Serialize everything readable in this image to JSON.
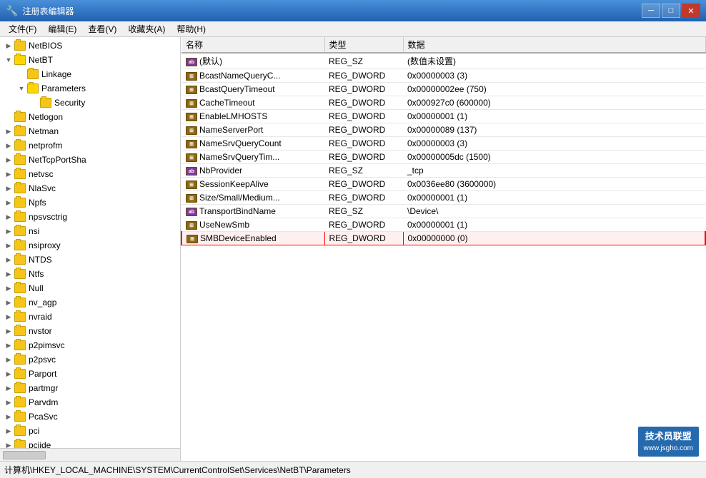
{
  "titleBar": {
    "title": "注册表编辑器",
    "iconUnicode": "🔧",
    "minBtn": "─",
    "maxBtn": "□",
    "closeBtn": "✕"
  },
  "menuBar": {
    "items": [
      {
        "label": "文件(F)"
      },
      {
        "label": "编辑(E)"
      },
      {
        "label": "查看(V)"
      },
      {
        "label": "收藏夹(A)"
      },
      {
        "label": "帮助(H)"
      }
    ]
  },
  "tree": {
    "items": [
      {
        "id": "netbios",
        "label": "NetBIOS",
        "level": 1,
        "expanded": false,
        "selected": false
      },
      {
        "id": "netbt",
        "label": "NetBT",
        "level": 1,
        "expanded": true,
        "selected": false
      },
      {
        "id": "linkage",
        "label": "Linkage",
        "level": 2,
        "expanded": false,
        "selected": false
      },
      {
        "id": "parameters",
        "label": "Parameters",
        "level": 2,
        "expanded": true,
        "selected": false
      },
      {
        "id": "security",
        "label": "Security",
        "level": 3,
        "expanded": false,
        "selected": false
      },
      {
        "id": "netlogon",
        "label": "Netlogon",
        "level": 1,
        "expanded": false,
        "selected": false
      },
      {
        "id": "netman",
        "label": "Netman",
        "level": 1,
        "expanded": false,
        "selected": false
      },
      {
        "id": "netprofm",
        "label": "netprofm",
        "level": 1,
        "expanded": false,
        "selected": false
      },
      {
        "id": "nettcpportsha",
        "label": "NetTcpPortSha",
        "level": 1,
        "expanded": false,
        "selected": false
      },
      {
        "id": "netvsc",
        "label": "netvsc",
        "level": 1,
        "expanded": false,
        "selected": false
      },
      {
        "id": "nlasvc",
        "label": "NlaSvc",
        "level": 1,
        "expanded": false,
        "selected": false
      },
      {
        "id": "npfs",
        "label": "Npfs",
        "level": 1,
        "expanded": false,
        "selected": false
      },
      {
        "id": "npsvsctrig",
        "label": "npsvsctrig",
        "level": 1,
        "expanded": false,
        "selected": false
      },
      {
        "id": "nsi",
        "label": "nsi",
        "level": 1,
        "expanded": false,
        "selected": false
      },
      {
        "id": "nsiproxy",
        "label": "nsiproxy",
        "level": 1,
        "expanded": false,
        "selected": false
      },
      {
        "id": "ntds",
        "label": "NTDS",
        "level": 1,
        "expanded": false,
        "selected": false
      },
      {
        "id": "ntfs",
        "label": "Ntfs",
        "level": 1,
        "expanded": false,
        "selected": false
      },
      {
        "id": "null",
        "label": "Null",
        "level": 1,
        "expanded": false,
        "selected": false
      },
      {
        "id": "nv_agp",
        "label": "nv_agp",
        "level": 1,
        "expanded": false,
        "selected": false
      },
      {
        "id": "nvraid",
        "label": "nvraid",
        "level": 1,
        "expanded": false,
        "selected": false
      },
      {
        "id": "nvstor",
        "label": "nvstor",
        "level": 1,
        "expanded": false,
        "selected": false
      },
      {
        "id": "p2pimsvc",
        "label": "p2pimsvc",
        "level": 1,
        "expanded": false,
        "selected": false
      },
      {
        "id": "p2psvc",
        "label": "p2psvc",
        "level": 1,
        "expanded": false,
        "selected": false
      },
      {
        "id": "parport",
        "label": "Parport",
        "level": 1,
        "expanded": false,
        "selected": false
      },
      {
        "id": "partmgr",
        "label": "partmgr",
        "level": 1,
        "expanded": false,
        "selected": false
      },
      {
        "id": "parvdm",
        "label": "Parvdm",
        "level": 1,
        "expanded": false,
        "selected": false
      },
      {
        "id": "pcasvc",
        "label": "PcaSvc",
        "level": 1,
        "expanded": false,
        "selected": false
      },
      {
        "id": "pci",
        "label": "pci",
        "level": 1,
        "expanded": false,
        "selected": false
      },
      {
        "id": "pciide",
        "label": "pciide",
        "level": 1,
        "expanded": false,
        "selected": false
      }
    ]
  },
  "tableHeaders": [
    "名称",
    "类型",
    "数据"
  ],
  "tableRows": [
    {
      "name": "(默认)",
      "typeIcon": "ab",
      "type": "REG_SZ",
      "data": "(数值未设置)"
    },
    {
      "name": "BcastNameQueryC...",
      "typeIcon": "reg",
      "type": "REG_DWORD",
      "data": "0x00000003 (3)"
    },
    {
      "name": "BcastQueryTimeout",
      "typeIcon": "reg",
      "type": "REG_DWORD",
      "data": "0x00000002ee (750)"
    },
    {
      "name": "CacheTimeout",
      "typeIcon": "reg",
      "type": "REG_DWORD",
      "data": "0x000927c0 (600000)"
    },
    {
      "name": "EnableLMHOSTS",
      "typeIcon": "reg",
      "type": "REG_DWORD",
      "data": "0x00000001 (1)"
    },
    {
      "name": "NameServerPort",
      "typeIcon": "reg",
      "type": "REG_DWORD",
      "data": "0x00000089 (137)"
    },
    {
      "name": "NameSrvQueryCount",
      "typeIcon": "reg",
      "type": "REG_DWORD",
      "data": "0x00000003 (3)"
    },
    {
      "name": "NameSrvQueryTim...",
      "typeIcon": "reg",
      "type": "REG_DWORD",
      "data": "0x00000005dc (1500)"
    },
    {
      "name": "NbProvider",
      "typeIcon": "ab",
      "type": "REG_SZ",
      "data": "_tcp"
    },
    {
      "name": "SessionKeepAlive",
      "typeIcon": "reg",
      "type": "REG_DWORD",
      "data": "0x0036ee80 (3600000)"
    },
    {
      "name": "Size/Small/Medium...",
      "typeIcon": "reg",
      "type": "REG_DWORD",
      "data": "0x00000001 (1)"
    },
    {
      "name": "TransportBindName",
      "typeIcon": "ab",
      "type": "REG_SZ",
      "data": "\\Device\\"
    },
    {
      "name": "UseNewSmb",
      "typeIcon": "reg",
      "type": "REG_DWORD",
      "data": "0x00000001 (1)"
    },
    {
      "name": "SMBDeviceEnabled",
      "typeIcon": "reg",
      "type": "REG_DWORD",
      "data": "0x00000000 (0)",
      "highlighted": true
    }
  ],
  "statusBar": {
    "text": "计算机\\HKEY_LOCAL_MACHINE\\SYSTEM\\CurrentControlSet\\Services\\NetBT\\Parameters"
  },
  "watermark": {
    "line1": "www.jsgho.com",
    "line2": "技术员联盟"
  }
}
